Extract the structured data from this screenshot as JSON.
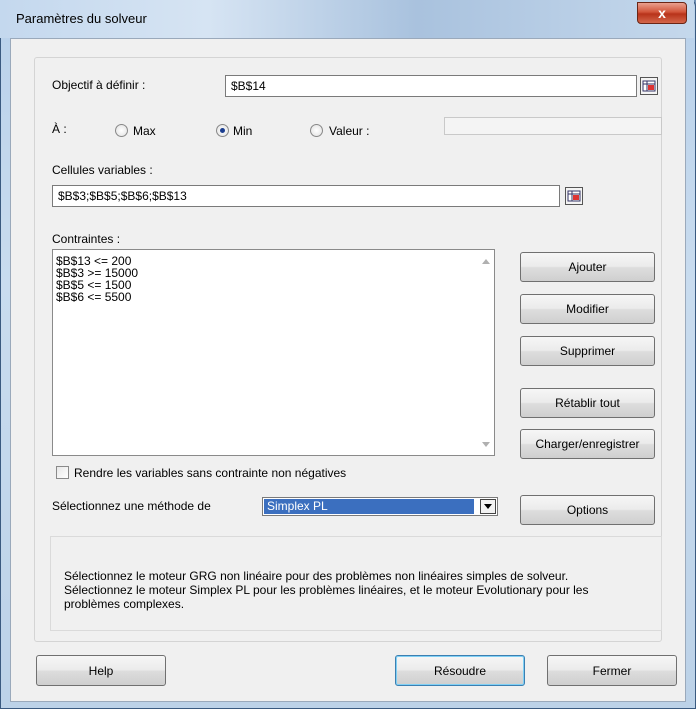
{
  "window": {
    "title": "Paramètres du solveur",
    "close_glyph": "x"
  },
  "objective": {
    "label": "Objectif à définir :",
    "label_underline_char_index": 8,
    "value": "$B$14"
  },
  "to": {
    "label": "À :",
    "options": [
      {
        "label": "Max",
        "selected": false
      },
      {
        "label": "Min",
        "selected": true
      },
      {
        "label": "Valeur :",
        "selected": false
      }
    ],
    "value_field": ""
  },
  "variables": {
    "label": "Cellules variables :",
    "value": "$B$3;$B$5;$B$6;$B$13"
  },
  "constraints": {
    "label": "Contraintes :",
    "items": [
      "$B$13 <= 200",
      "$B$3 >= 15000",
      "$B$5 <= 1500",
      "$B$6 <= 5500"
    ]
  },
  "side_buttons": {
    "add": "Ajouter",
    "modify": "Modifier",
    "delete": "Supprimer",
    "reset": "Rétablir tout",
    "load_save": "Charger/enregistrer"
  },
  "nonneg": {
    "label": "Rendre les variables sans contrainte non négatives",
    "checked": false
  },
  "method": {
    "label": "Sélectionnez une méthode de",
    "selected": "Simplex PL",
    "options_button": "Options"
  },
  "description": {
    "lines": [
      "Sélectionnez le moteur GRG non linéaire pour des problèmes non linéaires simples de solveur.",
      "Sélectionnez le moteur Simplex PL pour les problèmes linéaires, et le moteur Evolutionary pour les",
      "problèmes complexes."
    ]
  },
  "footer": {
    "help": "Help",
    "solve": "Résoudre",
    "close": "Fermer"
  },
  "colors": {
    "selection": "#3b6fbf",
    "close_button": "#c8442a",
    "default_button_border": "#3c7fb1"
  },
  "icons": {
    "ref_button": "range-select-icon",
    "radio": "radio-icon",
    "dropdown": "triangle-down-icon",
    "scroll": "scroll-arrow-icon"
  }
}
